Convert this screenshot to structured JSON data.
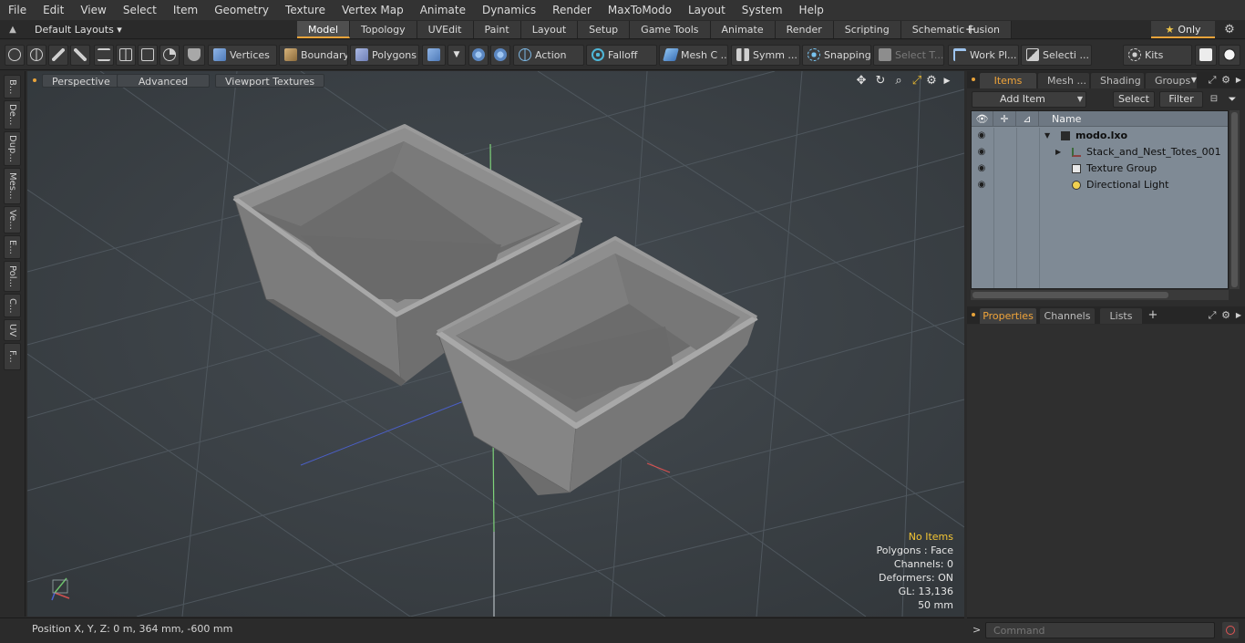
{
  "menu": [
    "File",
    "Edit",
    "View",
    "Select",
    "Item",
    "Geometry",
    "Texture",
    "Vertex Map",
    "Animate",
    "Dynamics",
    "Render",
    "MaxToModo",
    "Layout",
    "System",
    "Help"
  ],
  "layout_bar": {
    "preset": "Default Layouts ▾",
    "tabs": [
      "Model",
      "Topology",
      "UVEdit",
      "Paint",
      "Layout",
      "Setup",
      "Game Tools",
      "Animate",
      "Render",
      "Scripting",
      "Schematic Fusion"
    ],
    "active_tab": "Model",
    "add": "+",
    "only_label": "Only",
    "only_star": "★",
    "gear": "⚙"
  },
  "toolbar": {
    "vertices": "Vertices",
    "boundary": "Boundary",
    "polygons": "Polygons",
    "action": "Action",
    "falloff": "Falloff",
    "mesh_c": "Mesh C ...",
    "symm": "Symm ...",
    "snapping": "Snapping",
    "select_t": "Select T...",
    "work_pl": "Work Pl...",
    "selecti": "Selecti ...",
    "kits": "Kits"
  },
  "left_tabs": [
    "B...",
    "De...",
    "Dup...",
    "Mes...",
    "Ve...",
    "E...",
    "Pol...",
    "C...",
    "UV",
    "F..."
  ],
  "viewport": {
    "tabs": [
      "Perspective",
      "Advanced",
      "Viewport Textures"
    ],
    "info": {
      "selection": "No Items",
      "polygons": "Polygons : Face",
      "channels": "Channels: 0",
      "deformers": "Deformers: ON",
      "gl": "GL: 13,136",
      "scale": "50 mm"
    }
  },
  "items_panel": {
    "tabs": [
      "Items",
      "Mesh ...",
      "Shading",
      "Groups"
    ],
    "active_tab": "Items",
    "add_item": "Add Item",
    "select": "Select",
    "filter": "Filter",
    "header_name": "Name",
    "rows": [
      {
        "label": "modo.lxo",
        "bold": true
      },
      {
        "label": "Stack_and_Nest_Totes_001",
        "bold": false
      },
      {
        "label": "Texture Group",
        "bold": false
      },
      {
        "label": "Directional Light",
        "bold": false
      }
    ]
  },
  "props_panel": {
    "tabs": [
      "Properties",
      "Channels",
      "Lists"
    ],
    "active_tab": "Properties",
    "add": "+"
  },
  "status": {
    "position": "Position X, Y, Z:   0 m, 364 mm, -600 mm"
  },
  "command": {
    "prompt": ">",
    "placeholder": "Command"
  },
  "colors": {
    "accent": "#e8a33a",
    "viewport_bg": "#3a4045",
    "list_bg": "#7f8a95",
    "warning_text": "#f3c534"
  }
}
